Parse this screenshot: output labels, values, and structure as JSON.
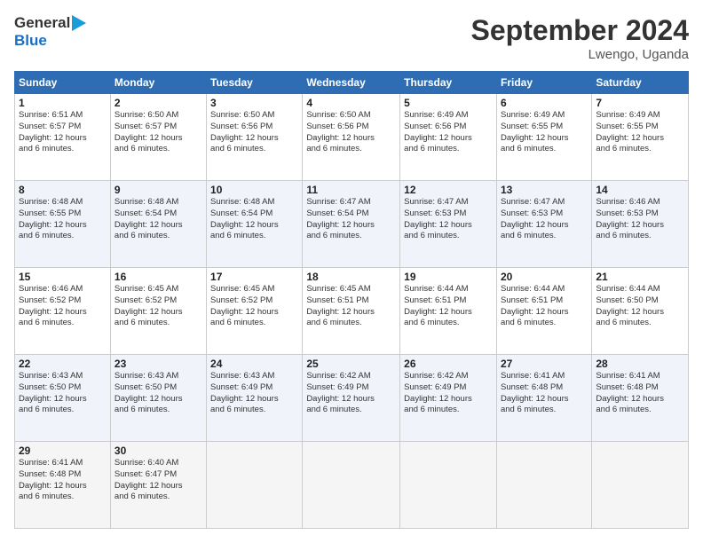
{
  "logo": {
    "line1": "General",
    "line2": "Blue",
    "arrow": "▶"
  },
  "header": {
    "month_year": "September 2024",
    "location": "Lwengo, Uganda"
  },
  "days_of_week": [
    "Sunday",
    "Monday",
    "Tuesday",
    "Wednesday",
    "Thursday",
    "Friday",
    "Saturday"
  ],
  "weeks": [
    [
      {
        "day": "1",
        "sunrise": "6:51 AM",
        "sunset": "6:57 PM",
        "daylight": "12 hours and 6 minutes."
      },
      {
        "day": "2",
        "sunrise": "6:50 AM",
        "sunset": "6:57 PM",
        "daylight": "12 hours and 6 minutes."
      },
      {
        "day": "3",
        "sunrise": "6:50 AM",
        "sunset": "6:56 PM",
        "daylight": "12 hours and 6 minutes."
      },
      {
        "day": "4",
        "sunrise": "6:50 AM",
        "sunset": "6:56 PM",
        "daylight": "12 hours and 6 minutes."
      },
      {
        "day": "5",
        "sunrise": "6:49 AM",
        "sunset": "6:56 PM",
        "daylight": "12 hours and 6 minutes."
      },
      {
        "day": "6",
        "sunrise": "6:49 AM",
        "sunset": "6:55 PM",
        "daylight": "12 hours and 6 minutes."
      },
      {
        "day": "7",
        "sunrise": "6:49 AM",
        "sunset": "6:55 PM",
        "daylight": "12 hours and 6 minutes."
      }
    ],
    [
      {
        "day": "8",
        "sunrise": "6:48 AM",
        "sunset": "6:55 PM",
        "daylight": "12 hours and 6 minutes."
      },
      {
        "day": "9",
        "sunrise": "6:48 AM",
        "sunset": "6:54 PM",
        "daylight": "12 hours and 6 minutes."
      },
      {
        "day": "10",
        "sunrise": "6:48 AM",
        "sunset": "6:54 PM",
        "daylight": "12 hours and 6 minutes."
      },
      {
        "day": "11",
        "sunrise": "6:47 AM",
        "sunset": "6:54 PM",
        "daylight": "12 hours and 6 minutes."
      },
      {
        "day": "12",
        "sunrise": "6:47 AM",
        "sunset": "6:53 PM",
        "daylight": "12 hours and 6 minutes."
      },
      {
        "day": "13",
        "sunrise": "6:47 AM",
        "sunset": "6:53 PM",
        "daylight": "12 hours and 6 minutes."
      },
      {
        "day": "14",
        "sunrise": "6:46 AM",
        "sunset": "6:53 PM",
        "daylight": "12 hours and 6 minutes."
      }
    ],
    [
      {
        "day": "15",
        "sunrise": "6:46 AM",
        "sunset": "6:52 PM",
        "daylight": "12 hours and 6 minutes."
      },
      {
        "day": "16",
        "sunrise": "6:45 AM",
        "sunset": "6:52 PM",
        "daylight": "12 hours and 6 minutes."
      },
      {
        "day": "17",
        "sunrise": "6:45 AM",
        "sunset": "6:52 PM",
        "daylight": "12 hours and 6 minutes."
      },
      {
        "day": "18",
        "sunrise": "6:45 AM",
        "sunset": "6:51 PM",
        "daylight": "12 hours and 6 minutes."
      },
      {
        "day": "19",
        "sunrise": "6:44 AM",
        "sunset": "6:51 PM",
        "daylight": "12 hours and 6 minutes."
      },
      {
        "day": "20",
        "sunrise": "6:44 AM",
        "sunset": "6:51 PM",
        "daylight": "12 hours and 6 minutes."
      },
      {
        "day": "21",
        "sunrise": "6:44 AM",
        "sunset": "6:50 PM",
        "daylight": "12 hours and 6 minutes."
      }
    ],
    [
      {
        "day": "22",
        "sunrise": "6:43 AM",
        "sunset": "6:50 PM",
        "daylight": "12 hours and 6 minutes."
      },
      {
        "day": "23",
        "sunrise": "6:43 AM",
        "sunset": "6:50 PM",
        "daylight": "12 hours and 6 minutes."
      },
      {
        "day": "24",
        "sunrise": "6:43 AM",
        "sunset": "6:49 PM",
        "daylight": "12 hours and 6 minutes."
      },
      {
        "day": "25",
        "sunrise": "6:42 AM",
        "sunset": "6:49 PM",
        "daylight": "12 hours and 6 minutes."
      },
      {
        "day": "26",
        "sunrise": "6:42 AM",
        "sunset": "6:49 PM",
        "daylight": "12 hours and 6 minutes."
      },
      {
        "day": "27",
        "sunrise": "6:41 AM",
        "sunset": "6:48 PM",
        "daylight": "12 hours and 6 minutes."
      },
      {
        "day": "28",
        "sunrise": "6:41 AM",
        "sunset": "6:48 PM",
        "daylight": "12 hours and 6 minutes."
      }
    ],
    [
      {
        "day": "29",
        "sunrise": "6:41 AM",
        "sunset": "6:48 PM",
        "daylight": "12 hours and 6 minutes."
      },
      {
        "day": "30",
        "sunrise": "6:40 AM",
        "sunset": "6:47 PM",
        "daylight": "12 hours and 6 minutes."
      },
      null,
      null,
      null,
      null,
      null
    ]
  ]
}
